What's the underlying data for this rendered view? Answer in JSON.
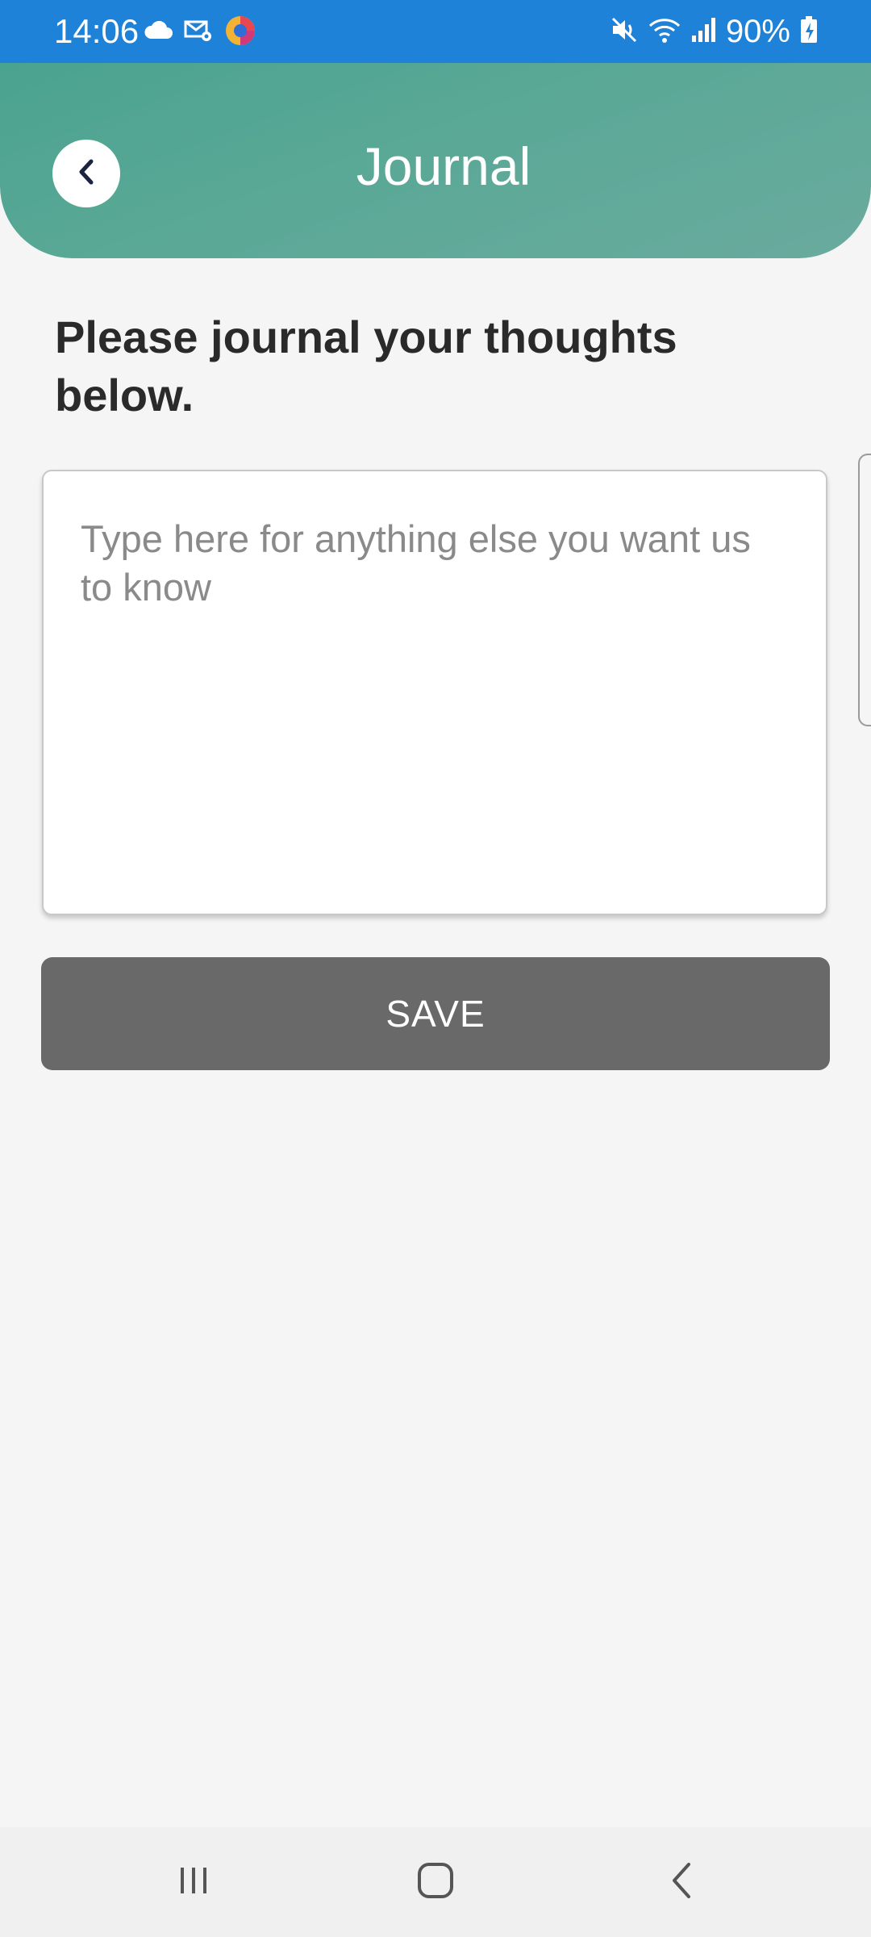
{
  "status_bar": {
    "time": "14:06",
    "battery": "90%",
    "left_icons": [
      "cloud-icon",
      "mail-settings-icon",
      "browser-icon"
    ],
    "right_icons": [
      "mute-icon",
      "wifi-icon",
      "signal-icon",
      "battery-charging-icon"
    ]
  },
  "header": {
    "title": "Journal",
    "back_icon": "chevron-left-icon",
    "colors": {
      "start": "#4aa38f",
      "end": "#6aab9e"
    }
  },
  "main": {
    "prompt": "Please journal your thoughts below.",
    "journal": {
      "value": "",
      "placeholder": "Type here for anything else you want us to know"
    },
    "save_label": "SAVE"
  },
  "nav_bar": {
    "items": [
      "recent-apps-icon",
      "home-icon",
      "back-icon"
    ]
  }
}
